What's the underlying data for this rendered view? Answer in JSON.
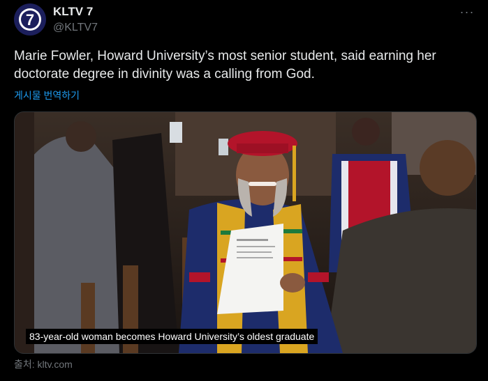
{
  "account": {
    "display_name": "KLTV 7",
    "handle": "@KLTV7",
    "avatar_icon": "kltv7-logo-icon",
    "avatar_logo_text": "7"
  },
  "menu": {
    "more_icon": "more-horizontal-icon",
    "more_label": "···"
  },
  "tweet": {
    "text_line1": "Marie Fowler, Howard University’s most senior student, said earning her",
    "text_line2": "doctorate degree in divinity was a calling from God.",
    "translate_label": "게시물 번역하기"
  },
  "media": {
    "caption": "83-year-old woman becomes Howard University’s oldest graduate",
    "accent_colors": {
      "cap": "#b3142a",
      "gown": "#1d2c6b",
      "tassel": "#d9a521"
    }
  },
  "footer": {
    "source": "출처: kltv.com"
  },
  "colors": {
    "background": "#000000",
    "text": "#e7e9ea",
    "muted": "#71767b",
    "link": "#1d9bf0"
  }
}
